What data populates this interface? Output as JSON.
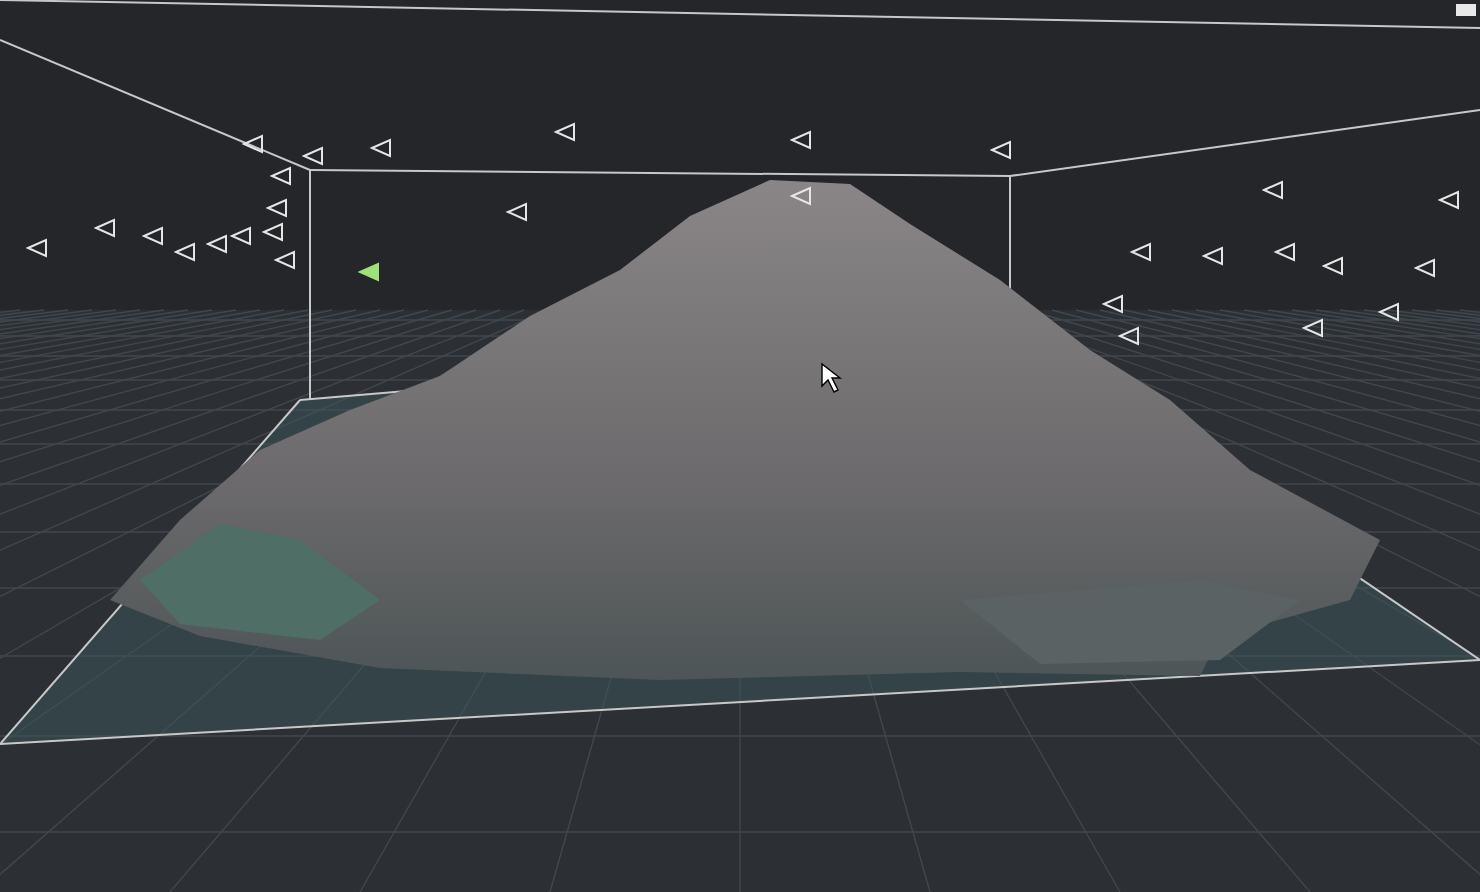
{
  "viewport": {
    "cameras": [
      {
        "selected": false
      },
      {
        "selected": false
      },
      {
        "selected": false
      },
      {
        "selected": false
      },
      {
        "selected": false
      },
      {
        "selected": false
      },
      {
        "selected": false
      },
      {
        "selected": false
      },
      {
        "selected": false
      },
      {
        "selected": false
      },
      {
        "selected": false
      },
      {
        "selected": false
      },
      {
        "selected": false
      },
      {
        "selected": false
      },
      {
        "selected": true
      },
      {
        "selected": false
      },
      {
        "selected": false
      },
      {
        "selected": false
      },
      {
        "selected": false
      },
      {
        "selected": false
      },
      {
        "selected": false
      },
      {
        "selected": false
      },
      {
        "selected": false
      },
      {
        "selected": false
      },
      {
        "selected": false
      },
      {
        "selected": false
      },
      {
        "selected": false
      },
      {
        "selected": false
      },
      {
        "selected": false
      },
      {
        "selected": false
      }
    ]
  }
}
